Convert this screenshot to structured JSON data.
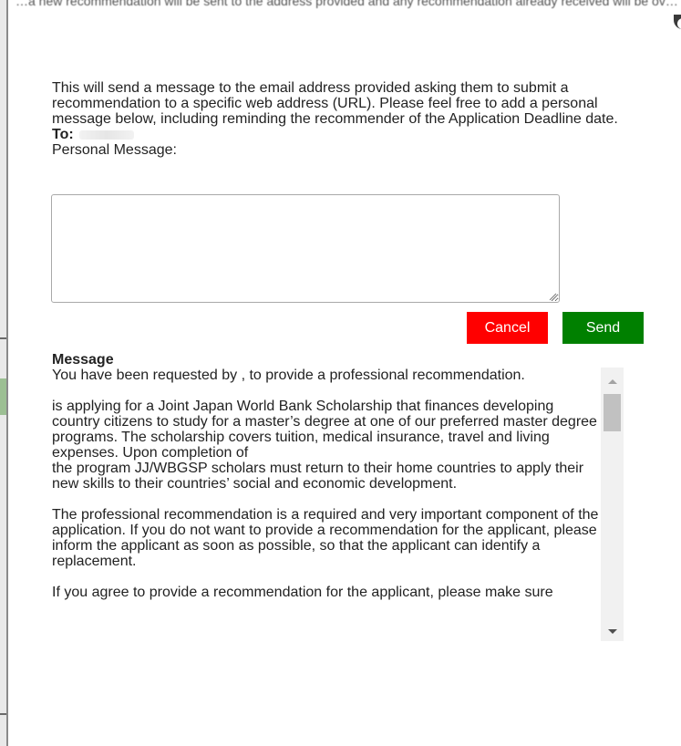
{
  "background": {
    "top_text": "…a new recommendation will be sent to the address provided and any recommendation already received will be ov…"
  },
  "intro": {
    "text": "This will send a message to the email address provided asking them to submit a recommendation to a specific web address (URL). Please feel free to add a personal message below, including reminding the recommender of the Application Deadline date."
  },
  "to": {
    "label": "To:"
  },
  "personal_message": {
    "label": "Personal Message:",
    "value": ""
  },
  "buttons": {
    "cancel": "Cancel",
    "send": "Send"
  },
  "message": {
    "heading": "Message",
    "paragraphs": [
      "You have been requested by , to provide a professional recommendation.",
      " is applying for a Joint Japan World Bank Scholarship that finances developing country citizens to study for a master’s degree at one of our preferred master degree programs. The scholarship covers tuition, medical insurance, travel and living expenses. Upon completion of\nthe program JJ/WBGSP scholars must return to their home countries to apply their new skills to their countries’ social and economic development.",
      "The professional recommendation is a required and very important component of the application. If you do not want to provide a recommendation for the applicant, please inform the applicant as soon as possible, so that the applicant can identify a replacement.",
      "If you agree to provide a recommendation for the applicant, please make sure"
    ]
  },
  "colors": {
    "cancel_bg": "#ff0000",
    "send_bg": "#008000",
    "text": "#222222"
  }
}
